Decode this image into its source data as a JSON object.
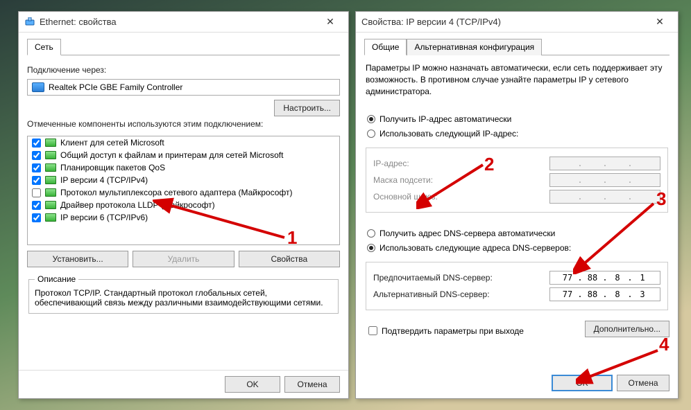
{
  "left": {
    "title": "Ethernet: свойства",
    "tab": "Сеть",
    "connect_label": "Подключение через:",
    "adapter_name": "Realtek PCIe GBE Family Controller",
    "configure_btn": "Настроить...",
    "components_label": "Отмеченные компоненты используются этим подключением:",
    "components": [
      {
        "checked": true,
        "label": "Клиент для сетей Microsoft"
      },
      {
        "checked": true,
        "label": "Общий доступ к файлам и принтерам для сетей Microsoft"
      },
      {
        "checked": true,
        "label": "Планировщик пакетов QoS"
      },
      {
        "checked": true,
        "label": "IP версии 4 (TCP/IPv4)"
      },
      {
        "checked": false,
        "label": "Протокол мультиплексора сетевого адаптера (Майкрософт)"
      },
      {
        "checked": true,
        "label": "Драйвер протокола LLDP (Майкрософт)"
      },
      {
        "checked": true,
        "label": "IP версии 6 (TCP/IPv6)"
      }
    ],
    "install_btn": "Установить...",
    "remove_btn": "Удалить",
    "props_btn": "Свойства",
    "desc_legend": "Описание",
    "desc_text": "Протокол TCP/IP. Стандартный протокол глобальных сетей, обеспечивающий связь между различными взаимодействующими сетями.",
    "ok": "OK",
    "cancel": "Отмена"
  },
  "right": {
    "title": "Свойства: IP версии 4 (TCP/IPv4)",
    "tab1": "Общие",
    "tab2": "Альтернативная конфигурация",
    "intro": "Параметры IP можно назначать автоматически, если сеть поддерживает эту возможность. В противном случае узнайте параметры IP у сетевого администратора.",
    "ip_auto": "Получить IP-адрес автоматически",
    "ip_manual": "Использовать следующий IP-адрес:",
    "ip_addr_lbl": "IP-адрес:",
    "mask_lbl": "Маска подсети:",
    "gw_lbl": "Основной шлюз:",
    "dns_auto": "Получить адрес DNS-сервера автоматически",
    "dns_manual": "Использовать следующие адреса DNS-серверов:",
    "dns1_lbl": "Предпочитаемый DNS-сервер:",
    "dns2_lbl": "Альтернативный DNS-сервер:",
    "dns1": [
      "77",
      "88",
      "8",
      "1"
    ],
    "dns2": [
      "77",
      "88",
      "8",
      "3"
    ],
    "validate": "Подтвердить параметры при выходе",
    "advanced": "Дополнительно...",
    "ok": "OK",
    "cancel": "Отмена"
  },
  "annotations": {
    "n1": "1",
    "n2": "2",
    "n3": "3",
    "n4": "4"
  }
}
